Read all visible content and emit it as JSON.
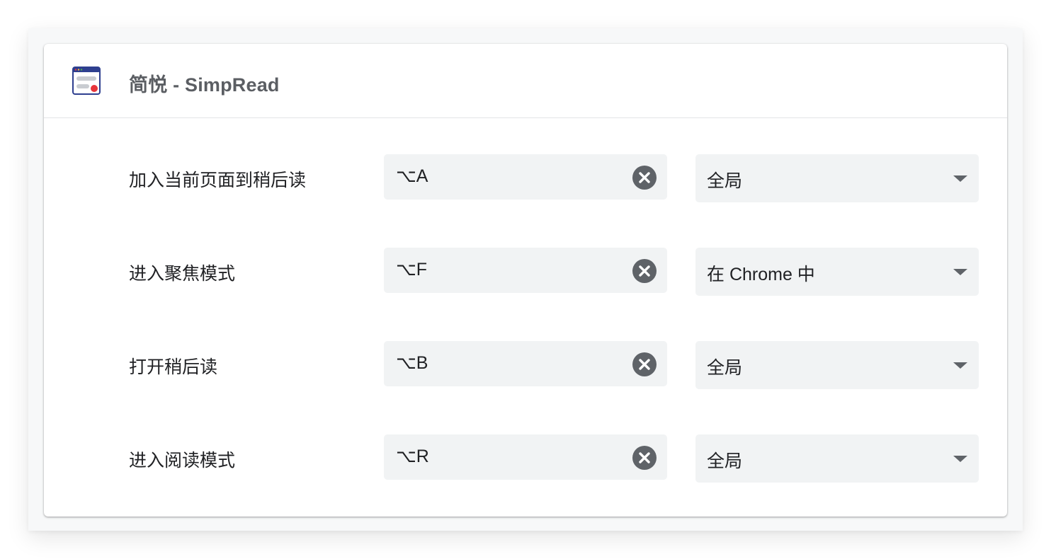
{
  "extension": {
    "title": "简悦 - SimpRead",
    "icon": "simpread-logo-icon"
  },
  "shortcuts": [
    {
      "label": "加入当前页面到稍后读",
      "key": "⌥A",
      "scope": "全局"
    },
    {
      "label": "进入聚焦模式",
      "key": "⌥F",
      "scope": "在 Chrome 中"
    },
    {
      "label": "打开稍后读",
      "key": "⌥B",
      "scope": "全局"
    },
    {
      "label": "进入阅读模式",
      "key": "⌥R",
      "scope": "全局"
    }
  ],
  "colors": {
    "field_background": "#f1f3f4",
    "clear_button": "#5f6368",
    "title_text": "#5b5e63",
    "logo_blue": "#2e3f8f",
    "logo_red": "#e8343b"
  }
}
